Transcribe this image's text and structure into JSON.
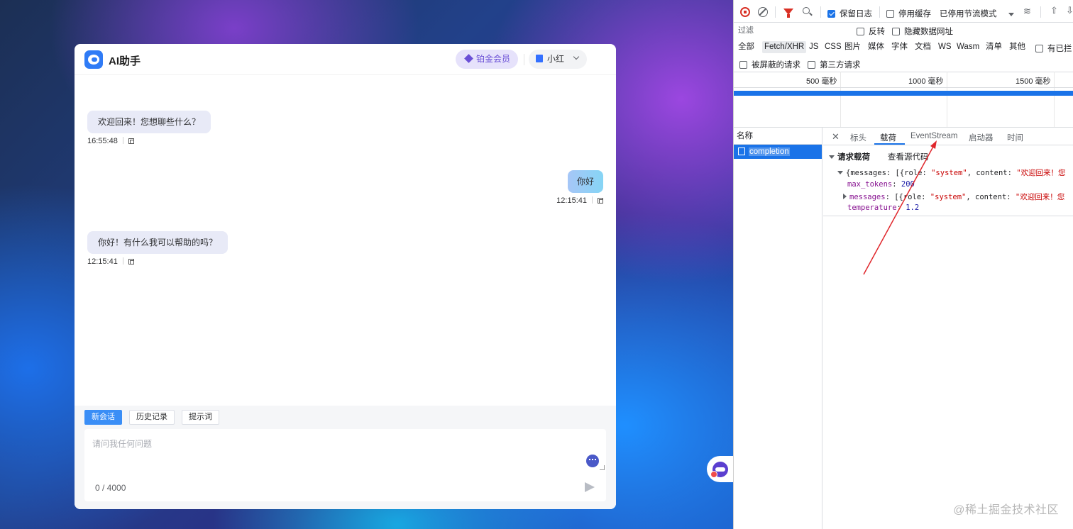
{
  "chat": {
    "app_title": "AI助手",
    "vip_label": "铂金会员",
    "user_name": "小红",
    "messages": [
      {
        "role": "assistant",
        "text": "欢迎回来！您想聊些什么？",
        "time": "16:55:48"
      },
      {
        "role": "user",
        "text": "你好",
        "time": "12:15:41"
      },
      {
        "role": "assistant",
        "text": "你好！有什么我可以帮助的吗？",
        "time": "12:15:41"
      }
    ],
    "tabs": {
      "new": "新会话",
      "history": "历史记录",
      "prompt": "提示词"
    },
    "input": {
      "placeholder": "请问我任何问题",
      "value": "",
      "counter": "0 / 4000"
    }
  },
  "devtools": {
    "toolbar": {
      "preserve_log": "保留日志",
      "disable_cache": "停用缓存",
      "throttle": "已停用节流模式"
    },
    "filter": {
      "placeholder": "过滤",
      "invert": "反转",
      "hide_data_urls": "隐藏数据网址"
    },
    "types": [
      "全部",
      "Fetch/XHR",
      "JS",
      "CSS",
      "图片",
      "媒体",
      "字体",
      "文档",
      "WS",
      "Wasm",
      "清单",
      "其他"
    ],
    "blocked_cookies": "有已拦",
    "blocked_requests": "被屏蔽的请求",
    "third_party": "第三方请求",
    "timeline": [
      "500 毫秒",
      "1000 毫秒",
      "1500 毫秒"
    ],
    "name_header": "名称",
    "request_name": "completion",
    "detail_tabs": [
      "标头",
      "载荷",
      "EventStream",
      "启动器",
      "时间"
    ],
    "payload": {
      "title": "请求载荷",
      "view_source": "查看源代码",
      "line1_prefix": "{messages: [{role: ",
      "line1_role": "\"system\"",
      "line1_mid": ", content: ",
      "line1_content": "\"欢迎回来！您",
      "max_tokens_key": "max_tokens",
      "max_tokens_val": "200",
      "messages_key": "messages",
      "messages_prefix": ": [{role: ",
      "messages_role": "\"system\"",
      "messages_mid": ", content: ",
      "messages_content": "\"欢迎回来！您",
      "temperature_key": "temperature",
      "temperature_val": "1.2"
    },
    "watermark": "@稀土掘金技术社区"
  },
  "colors": {
    "accent": "#3a8ef6",
    "vip": "#6a4fd6",
    "devtools_blue": "#1a73e8",
    "arrow": "#e0262b"
  }
}
